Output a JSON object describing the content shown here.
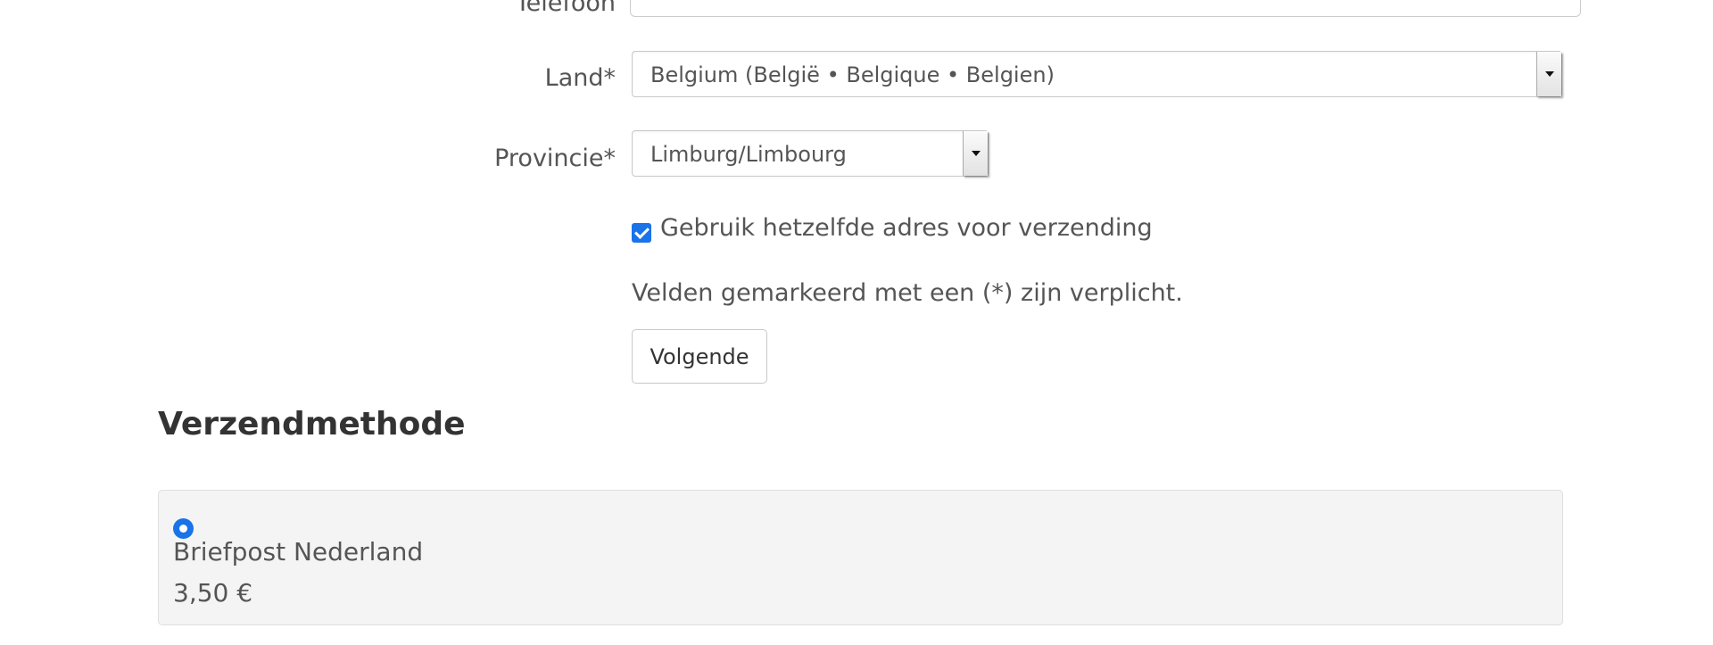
{
  "form": {
    "telefoon_label": "Telefoon",
    "land": {
      "label": "Land*",
      "selected": "Belgium (België • Belgique • Belgien)"
    },
    "provincie": {
      "label": "Provincie*",
      "selected": "Limburg/Limbourg"
    },
    "same_address": {
      "label": "Gebruik hetzelfde adres voor verzending",
      "checked": true
    },
    "required_note": "Velden gemarkeerd met een (*) zijn verplicht.",
    "next_button": "Volgende"
  },
  "shipping": {
    "title": "Verzendmethode",
    "methods": [
      {
        "name": "Briefpost Nederland",
        "price": "3,50 €",
        "selected": true
      }
    ]
  },
  "colors": {
    "accent": "#1a73e8",
    "text": "#555555",
    "heading": "#333333",
    "panel_bg": "#f4f4f4"
  }
}
